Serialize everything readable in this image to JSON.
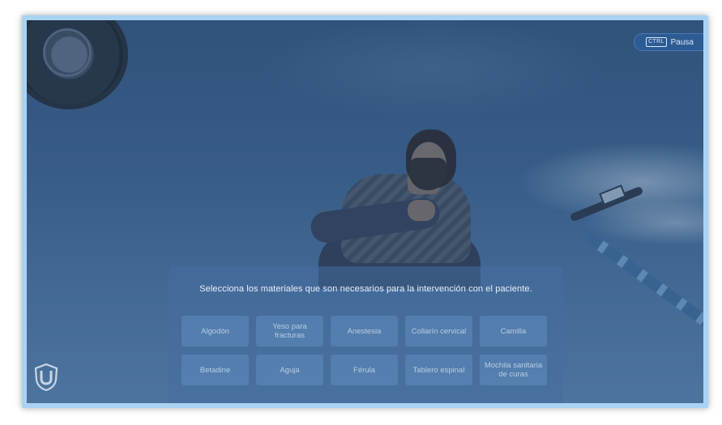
{
  "hud": {
    "pause": {
      "key_label": "CTRL",
      "label": "Pausa"
    }
  },
  "panel": {
    "title": "Selecciona los materiales que son necesarios para la intervención con el paciente.",
    "options": [
      "Algodón",
      "Yeso para fracturas",
      "Anestesia",
      "Collarín cervical",
      "Camilla",
      "Betadine",
      "Aguja",
      "Férula",
      "Tablero espinal",
      "Mochila sanitaria de curas"
    ]
  },
  "colors": {
    "frame_border": "#a9d3f2",
    "panel_bg": "#466ea0",
    "option_bg": "#5f8cbe",
    "option_text": "#b8cde2",
    "pause_bg": "#2d5b93"
  },
  "icons": {
    "logo": "shield-u-logo-icon",
    "ctrl": "ctrl-key-icon"
  }
}
